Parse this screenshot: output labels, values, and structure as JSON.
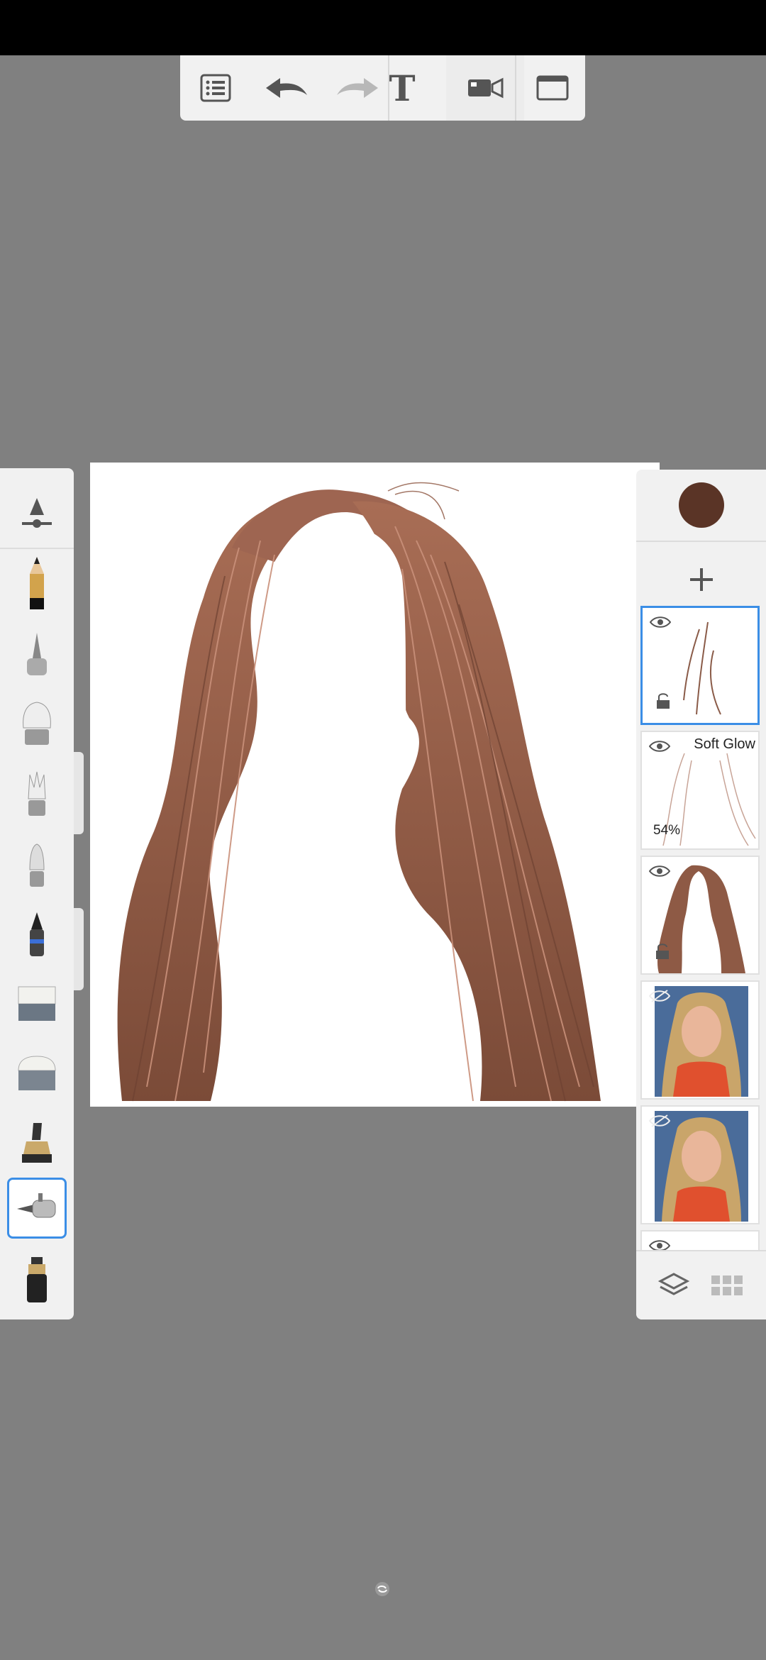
{
  "toolbar": {
    "items": [
      {
        "icon": "list-icon"
      },
      {
        "icon": "undo-icon"
      },
      {
        "icon": "redo-icon"
      },
      {
        "icon": "text-icon",
        "label": "T"
      },
      {
        "icon": "record-video-icon"
      },
      {
        "icon": "fullscreen-icon"
      }
    ]
  },
  "brushes": [
    "brush-settings-icon",
    "pencil-icon",
    "ballpoint-pen-icon",
    "paint-brush-icon",
    "fan-brush-icon",
    "flat-brush-icon",
    "marker-icon",
    "eraser-icon",
    "soft-eraser-icon",
    "smudge-icon",
    "airbrush-icon",
    "ink-pen-icon",
    "fine-pen-icon"
  ],
  "layers": {
    "current_color": "#5a3426",
    "add_label": "+",
    "items": [
      {
        "name": "",
        "opacity": "",
        "visible": true,
        "selected": true
      },
      {
        "name": "Soft Glow",
        "opacity": "54%",
        "visible": true,
        "selected": false
      },
      {
        "name": "",
        "opacity": "",
        "visible": true,
        "selected": false
      },
      {
        "name": "",
        "opacity": "",
        "visible": false,
        "selected": false
      },
      {
        "name": "",
        "opacity": "",
        "visible": false,
        "selected": false
      },
      {
        "name": "",
        "opacity": "",
        "visible": true,
        "selected": false
      }
    ]
  },
  "colors": {
    "accent": "#3b8ee6",
    "hair": "#9b6650",
    "background": "#808080"
  }
}
